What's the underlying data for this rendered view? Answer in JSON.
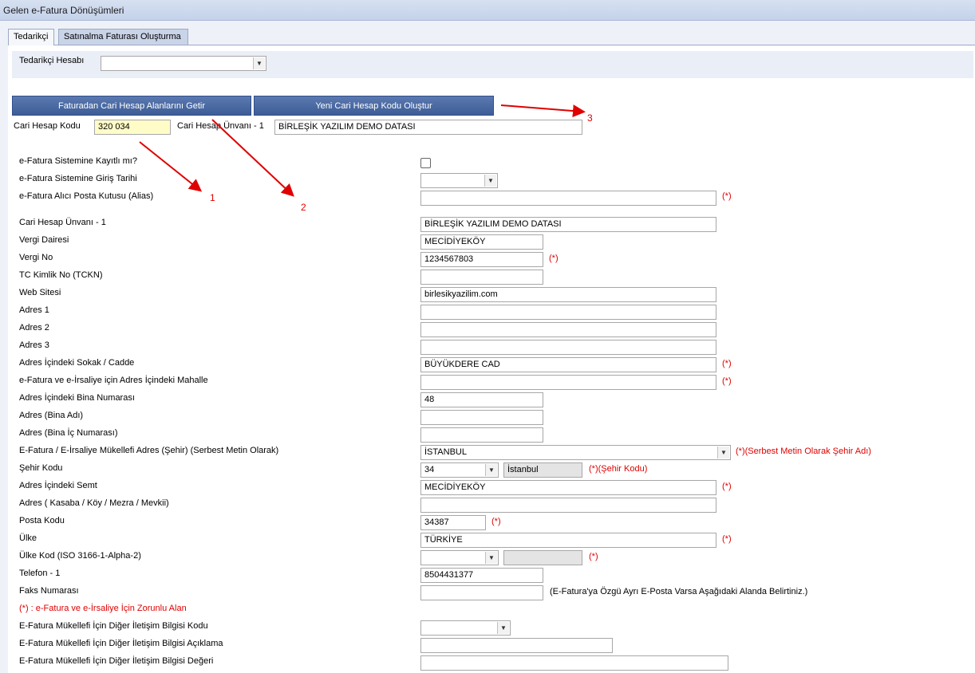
{
  "window": {
    "title": "Gelen e-Fatura Dönüşümleri"
  },
  "tabs": [
    {
      "label": "Tedarikçi",
      "active": true
    },
    {
      "label": "Satınalma Faturası Oluşturma",
      "active": false
    }
  ],
  "supplier": {
    "label": "Tedarikçi Hesabı",
    "value": ""
  },
  "buttons": {
    "fetch_fields": "Faturadan Cari Hesap Alanlarını Getir",
    "new_code": "Yeni Cari Hesap Kodu Oluştur"
  },
  "account": {
    "code_label": "Cari Hesap Kodu",
    "code_value": "320 034",
    "title_label": "Cari Hesap Ünvanı - 1",
    "title_value": "BİRLEŞİK YAZILIM DEMO DATASI"
  },
  "annotations": [
    "1",
    "2",
    "3"
  ],
  "form": {
    "registered_label": "e-Fatura Sistemine Kayıtlı mı?",
    "entry_date_label": "e-Fatura Sistemine Giriş Tarihi",
    "alias_label": "e-Fatura Alıcı Posta Kutusu (Alias)",
    "alias_value": "",
    "title_label": "Cari Hesap Ünvanı - 1",
    "title_value": "BİRLEŞİK YAZILIM DEMO DATASI",
    "tax_office_label": "Vergi Dairesi",
    "tax_office_value": "MECİDİYEKÖY",
    "tax_no_label": "Vergi No",
    "tax_no_value": "1234567803",
    "tckn_label": "TC Kimlik No (TCKN)",
    "tckn_value": "",
    "web_label": "Web Sitesi",
    "web_value": "birlesikyazilim.com",
    "addr1_label": "Adres 1",
    "addr1_value": "",
    "addr2_label": "Adres 2",
    "addr2_value": "",
    "addr3_label": "Adres 3",
    "addr3_value": "",
    "street_label": "Adres İçindeki Sokak / Cadde",
    "street_value": "BÜYÜKDERE CAD",
    "district_label": "e-Fatura ve e-İrsaliye için Adres İçindeki Mahalle",
    "district_value": "",
    "building_no_label": "Adres İçindeki Bina Numarası",
    "building_no_value": "48",
    "building_name_label": "Adres (Bina Adı)",
    "building_name_value": "",
    "door_no_label": "Adres (Bina İç Numarası)",
    "door_no_value": "",
    "city_label": "E-Fatura / E-İrsaliye Mükellefi Adres (Şehir) (Serbest Metin Olarak)",
    "city_value": "İSTANBUL",
    "city_note": "(*)(Serbest Metin Olarak Şehir Adı)",
    "city_code_label": "Şehir Kodu",
    "city_code_value": "34",
    "city_code_name": "İstanbul",
    "city_code_note": "(*)(Şehir Kodu)",
    "semt_label": "Adres İçindeki Semt",
    "semt_value": "MECİDİYEKÖY",
    "town_label": "Adres ( Kasaba / Köy / Mezra / Mevkii)",
    "town_value": "",
    "postal_label": "Posta Kodu",
    "postal_value": "34387",
    "country_label": "Ülke",
    "country_value": "TÜRKİYE",
    "country_code_label": "Ülke Kod (ISO 3166-1-Alpha-2)",
    "phone_label": "Telefon - 1",
    "phone_value": "8504431377",
    "fax_label": "Faks Numarası",
    "fax_value": "",
    "fax_note": "(E-Fatura'ya Özgü Ayrı E-Posta Varsa Aşağıdaki Alanda Belirtiniz.)",
    "required_note": "(*) : e-Fatura ve e-İrsaliye İçin Zorunlu Alan",
    "other_code_label": "E-Fatura Mükellefi İçin Diğer İletişim Bilgisi Kodu",
    "other_desc_label": "E-Fatura Mükellefi İçin Diğer İletişim Bilgisi Açıklama",
    "other_desc_value": "",
    "other_value_label": "E-Fatura Mükellefi İçin Diğer İletişim Bilgisi Değeri",
    "other_value_value": "",
    "req_mark": "(*)"
  },
  "colors": {
    "required": "#e00000",
    "button": "#3d5d97",
    "highlight": "#fffcc8"
  }
}
